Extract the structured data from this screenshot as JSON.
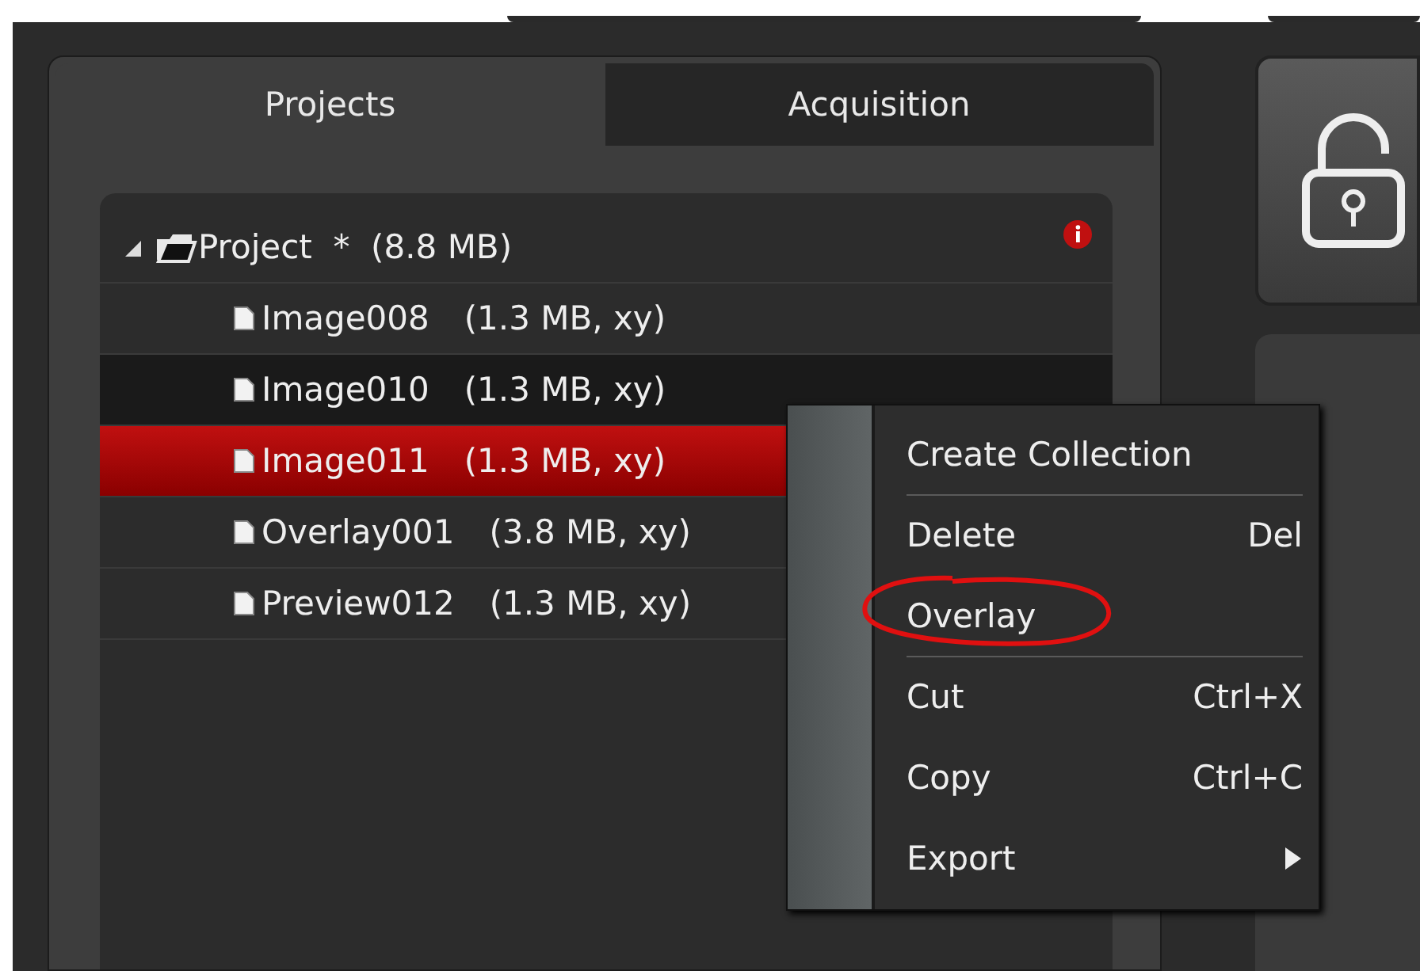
{
  "tabs": [
    {
      "label": "Projects",
      "selected": true
    },
    {
      "label": "Acquisition",
      "selected": false
    }
  ],
  "tree": {
    "label": "Project  *  (8.8 MB)",
    "expanded": true,
    "warning": true,
    "children": [
      {
        "name": "Image008",
        "info": "(1.3 MB, xy)",
        "selected": false,
        "hovered": false
      },
      {
        "name": "Image010",
        "info": "(1.3 MB, xy)",
        "selected": false,
        "hovered": true
      },
      {
        "name": "Image011",
        "info": "(1.3 MB, xy)",
        "selected": true,
        "hovered": false
      },
      {
        "name": "Overlay001",
        "info": "(3.8 MB, xy)",
        "selected": false,
        "hovered": false
      },
      {
        "name": "Preview012",
        "info": "(1.3 MB, xy)",
        "selected": false,
        "hovered": false
      }
    ]
  },
  "lock": {
    "locked": false
  },
  "context_menu": {
    "items": [
      {
        "label": "Create Collection",
        "separator_after": true,
        "submenu": false,
        "circled": false
      },
      {
        "label": "Delete",
        "shortcut": "Del",
        "separator_after": false,
        "submenu": false,
        "circled": false
      },
      {
        "label": "Overlay",
        "separator_after": true,
        "submenu": false,
        "circled": true
      },
      {
        "label": "Cut",
        "shortcut": "Ctrl+X",
        "separator_after": false,
        "submenu": false,
        "circled": false
      },
      {
        "label": "Copy",
        "shortcut": "Ctrl+C",
        "separator_after": false,
        "submenu": false,
        "circled": false
      },
      {
        "label": "Export",
        "separator_after": false,
        "submenu": true,
        "circled": false
      }
    ]
  }
}
